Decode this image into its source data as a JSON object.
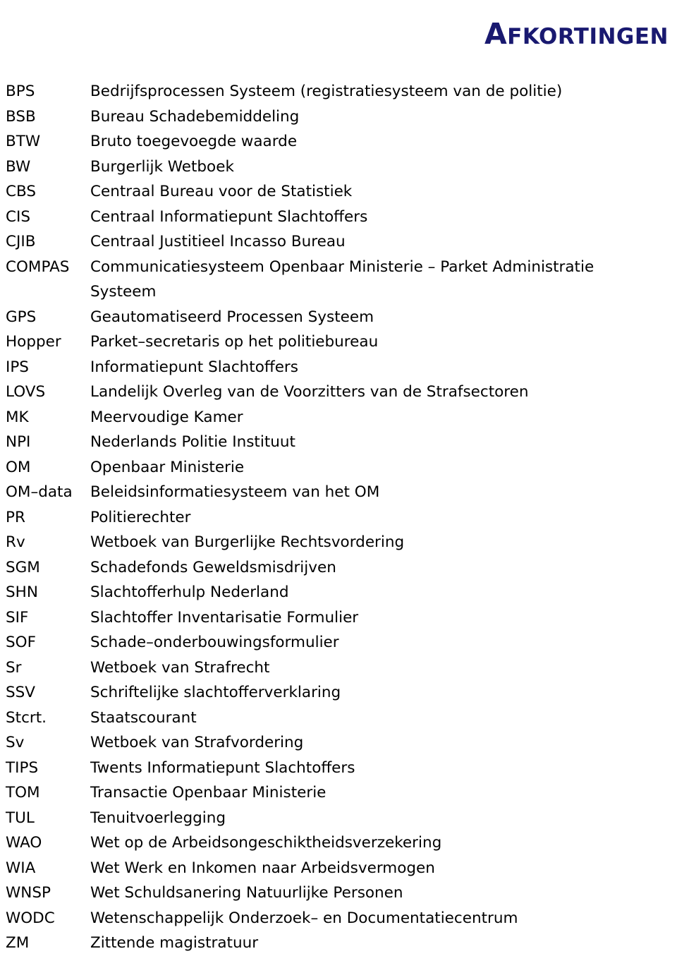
{
  "title": {
    "text": "AFKORTINGEN",
    "first_letter": "A",
    "rest_letters": "FKORTINGEN",
    "color": "#191970"
  },
  "list": {
    "rows": [
      {
        "term": "BPS",
        "definition": "Bedrijfsprocessen Systeem (registratiesysteem van de politie)",
        "continuation": false
      },
      {
        "term": "BSB",
        "definition": "Bureau Schadebemiddeling",
        "continuation": false
      },
      {
        "term": "BTW",
        "definition": "Bruto toegevoegde waarde",
        "continuation": false
      },
      {
        "term": "BW",
        "definition": "Burgerlijk Wetboek",
        "continuation": false
      },
      {
        "term": "CBS",
        "definition": "Centraal Bureau voor de Statistiek",
        "continuation": false
      },
      {
        "term": "CIS",
        "definition": "Centraal Informatiepunt Slachtoffers",
        "continuation": false
      },
      {
        "term": "CJIB",
        "definition": "Centraal Justitieel Incasso Bureau",
        "continuation": false
      },
      {
        "term": "COMPAS",
        "definition": "Communicatiesysteem Openbaar Ministerie – Parket Administratie",
        "continuation": false
      },
      {
        "term": "",
        "definition": "Systeem",
        "continuation": true
      },
      {
        "term": "GPS",
        "definition": "Geautomatiseerd Processen Systeem",
        "continuation": false
      },
      {
        "term": "Hopper",
        "definition": "Parket–secretaris op het politiebureau",
        "continuation": false
      },
      {
        "term": "IPS",
        "definition": "Informatiepunt Slachtoffers",
        "continuation": false
      },
      {
        "term": "LOVS",
        "definition": "Landelijk Overleg van de Voorzitters van de Strafsectoren",
        "continuation": false
      },
      {
        "term": "MK",
        "definition": "Meervoudige Kamer",
        "continuation": false
      },
      {
        "term": "NPI",
        "definition": "Nederlands Politie Instituut",
        "continuation": false
      },
      {
        "term": "OM",
        "definition": "Openbaar Ministerie",
        "continuation": false
      },
      {
        "term": "OM–data",
        "definition": "Beleidsinformatiesysteem van het OM",
        "continuation": false
      },
      {
        "term": "PR",
        "definition": "Politierechter",
        "continuation": false
      },
      {
        "term": "Rv",
        "definition": "Wetboek van Burgerlijke Rechtsvordering",
        "continuation": false
      },
      {
        "term": "SGM",
        "definition": "Schadefonds Geweldsmisdrijven",
        "continuation": false
      },
      {
        "term": "SHN",
        "definition": "Slachtofferhulp Nederland",
        "continuation": false
      },
      {
        "term": "SIF",
        "definition": "Slachtoffer Inventarisatie Formulier",
        "continuation": false
      },
      {
        "term": "SOF",
        "definition": "Schade–onderbouwingsformulier",
        "continuation": false
      },
      {
        "term": "Sr",
        "definition": "Wetboek van Strafrecht",
        "continuation": false
      },
      {
        "term": "SSV",
        "definition": "Schriftelijke slachtofferverklaring",
        "continuation": false
      },
      {
        "term": "Stcrt.",
        "definition": "Staatscourant",
        "continuation": false
      },
      {
        "term": "Sv",
        "definition": "Wetboek van Strafvordering",
        "continuation": false
      },
      {
        "term": "TIPS",
        "definition": "Twents Informatiepunt Slachtoffers",
        "continuation": false
      },
      {
        "term": "TOM",
        "definition": "Transactie Openbaar Ministerie",
        "continuation": false
      },
      {
        "term": "TUL",
        "definition": "Tenuitvoerlegging",
        "continuation": false
      },
      {
        "term": "WAO",
        "definition": "Wet op de Arbeidsongeschiktheidsverzekering",
        "continuation": false
      },
      {
        "term": "WIA",
        "definition": "Wet Werk en Inkomen naar Arbeidsvermogen",
        "continuation": false
      },
      {
        "term": "WNSP",
        "definition": "Wet Schuldsanering Natuurlijke Personen",
        "continuation": false
      },
      {
        "term": "WODC",
        "definition": "Wetenschappelijk Onderzoek– en Documentatiecentrum",
        "continuation": false
      },
      {
        "term": "ZM",
        "definition": "Zittende magistratuur",
        "continuation": false
      }
    ]
  }
}
